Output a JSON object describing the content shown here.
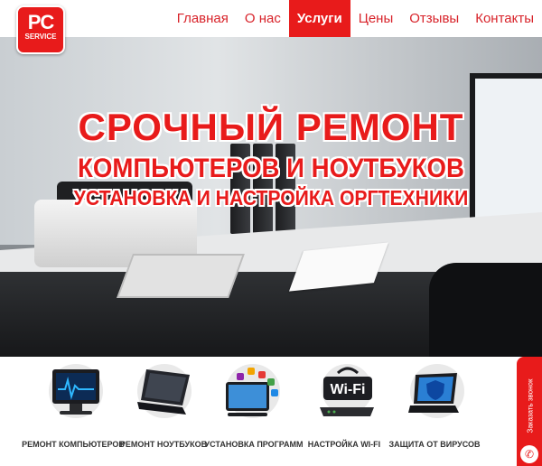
{
  "logo": {
    "line1": "PC",
    "line2": "SERVICE"
  },
  "nav": {
    "items": [
      {
        "label": "Главная"
      },
      {
        "label": "О нас"
      },
      {
        "label": "Услуги",
        "active": true
      },
      {
        "label": "Цены"
      },
      {
        "label": "Отзывы"
      },
      {
        "label": "Контакты"
      }
    ]
  },
  "hero": {
    "title": "СРОЧНЫЙ РЕМОНТ",
    "subtitle": "КОМПЬЮТЕРОВ И НОУТБУКОВ",
    "subtitle2": "УСТАНОВКА  И  НАСТРОЙКА ОРГТЕХНИКИ"
  },
  "services": [
    {
      "label": "РЕМОНТ КОМПЬЮТЕРОВ",
      "icon": "computer-monitor-icon"
    },
    {
      "label": "РЕМОНТ НОУТБУКОВ",
      "icon": "laptop-icon"
    },
    {
      "label": "УСТАНОВКА ПРОГРАММ",
      "icon": "software-apps-icon"
    },
    {
      "label": "НАСТРОЙКА WI-FI",
      "icon": "wifi-router-icon"
    },
    {
      "label": "ЗАЩИТА ОТ ВИРУСОВ",
      "icon": "antivirus-shield-icon"
    }
  ],
  "callback": {
    "label": "Заказать звонок",
    "icon": "phone-icon"
  },
  "colors": {
    "accent": "#e81b1b",
    "nav_text": "#d8232a"
  }
}
